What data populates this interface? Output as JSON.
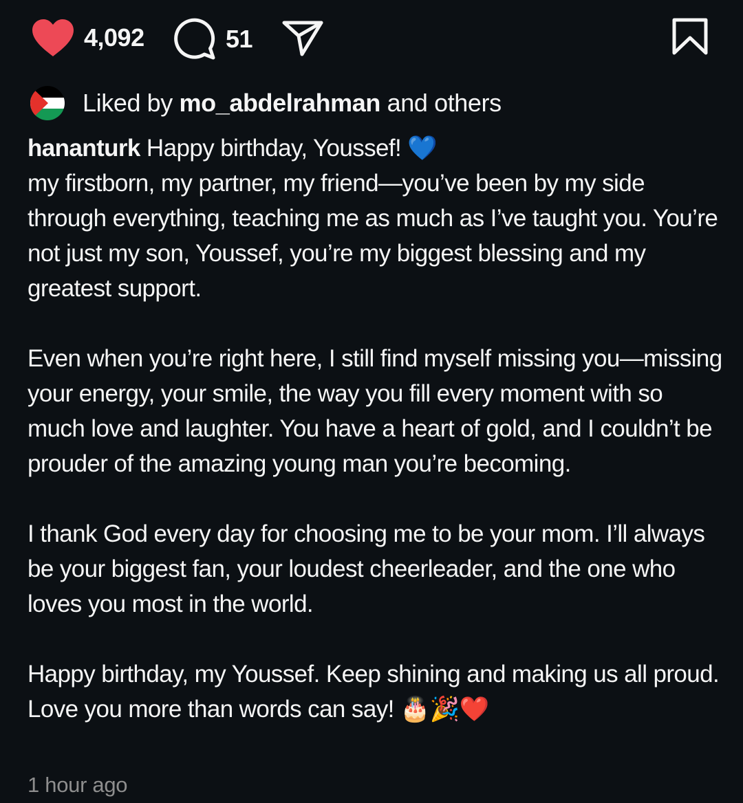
{
  "actions": {
    "like_count": "4,092",
    "comment_count": "51",
    "liked": true,
    "like_color": "#ed4956"
  },
  "liked_by": {
    "prefix": "Liked by",
    "user": "mo_abdelrahman",
    "suffix": "and others",
    "avatar_icon": "palestine-flag-icon"
  },
  "caption": {
    "username": "hananturk",
    "first_line": "Happy birthday, Youssef! 💙",
    "p1": "my firstborn, my partner, my friend—you’ve been by my side through everything, teaching me as much as I’ve taught you. You’re not just my son, Youssef, you’re my biggest blessing and my greatest support.",
    "p2": "Even when you’re right here, I still find myself missing you—missing your energy, your smile, the way you fill every moment with so much love and laughter. You have a heart of gold, and I couldn’t be prouder of the amazing young man you’re becoming.",
    "p3": "I thank God every day for choosing me to be your mom. I’ll always be your biggest fan, your loudest cheerleader, and the one who loves you most in the world.",
    "p4": "Happy birthday, my Youssef. Keep shining and making us all proud. Love you more than words can say! 🎂🎉❤️"
  },
  "timestamp": "1 hour ago"
}
